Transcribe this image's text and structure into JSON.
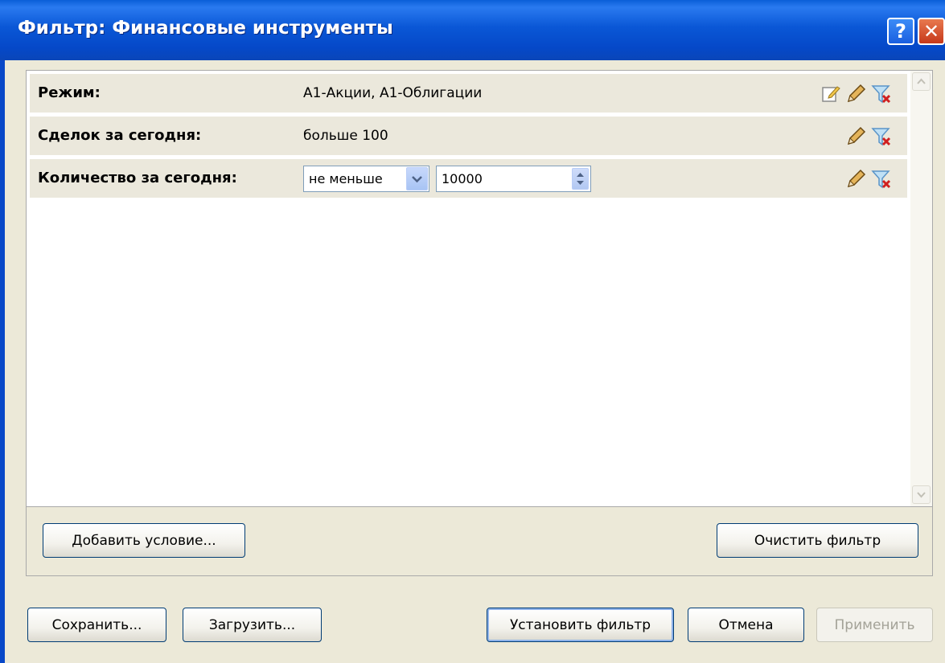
{
  "window": {
    "title": "Фильтр: Финансовые инструменты",
    "help_label": "?",
    "close_label": "✕"
  },
  "conditions": [
    {
      "label": "Режим:",
      "value": "А1-Акции, А1-Облигации"
    },
    {
      "label": "Сделок за сегодня:",
      "value": "больше 100"
    },
    {
      "label": "Количество за сегодня:",
      "operator": "не меньше",
      "amount": "10000"
    }
  ],
  "panel_buttons": {
    "add_condition": "Добавить условие...",
    "clear_filter": "Очистить фильтр"
  },
  "dialog_buttons": {
    "save": "Сохранить...",
    "load": "Загрузить...",
    "set_filter": "Установить фильтр",
    "cancel": "Отмена",
    "apply": "Применить"
  }
}
